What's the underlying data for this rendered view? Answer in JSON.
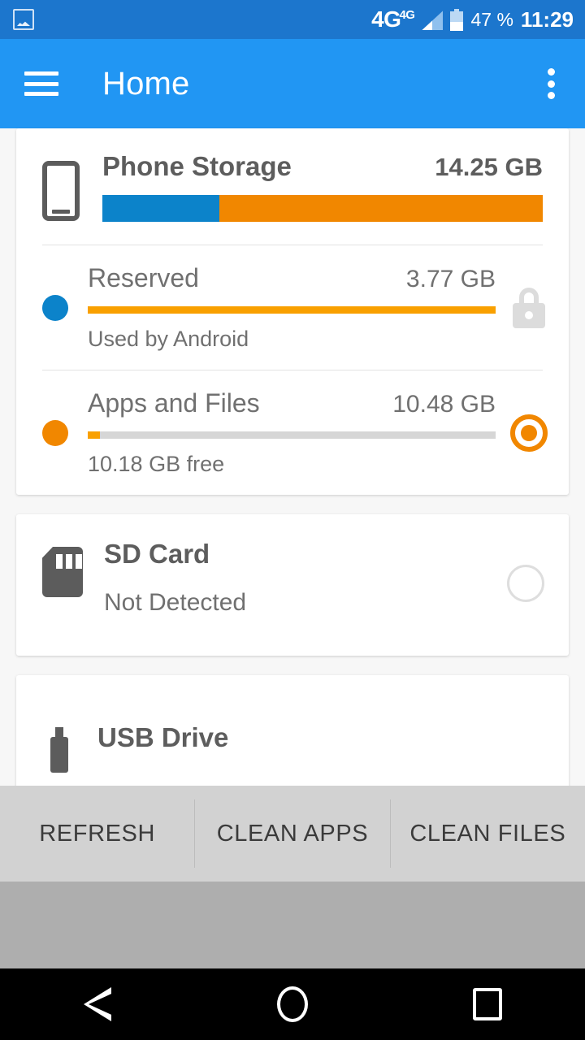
{
  "status_bar": {
    "notification_icon": "image-icon",
    "network_label": "4G",
    "network_sup": "4G",
    "battery_percent": "47 %",
    "clock": "11:29",
    "bar_color": "#1c76cd"
  },
  "app_bar": {
    "menu_icon": "hamburger-icon",
    "title": "Home",
    "overflow_icon": "more-vert-icon",
    "bar_color": "#2196f3"
  },
  "colors": {
    "blue": "#0c83ca",
    "orange": "#f18700",
    "orange_light": "#f9a000",
    "track": "#d6d6d6",
    "text": "#707070",
    "title": "#5d5d5d"
  },
  "phone_storage": {
    "icon": "phone-icon",
    "title": "Phone Storage",
    "size": "14.25 GB",
    "stacked_bar": {
      "segments": [
        {
          "label": "Reserved",
          "color": "#0c83ca",
          "percent": 26.5
        },
        {
          "label": "Apps and Files",
          "color": "#f18700",
          "percent": 73.5
        }
      ]
    },
    "rows": [
      {
        "dot_color": "#0c83ca",
        "name": "Reserved",
        "size": "3.77 GB",
        "bar_percent": 100,
        "note": "Used by Android",
        "trailing_icon": "lock-icon",
        "trailing_type": "lock"
      },
      {
        "dot_color": "#f18700",
        "name": "Apps and Files",
        "size": "10.48 GB",
        "bar_percent": 3,
        "note": "10.18 GB free",
        "trailing_icon": "radio-button-checked-icon",
        "trailing_type": "radio-on"
      }
    ]
  },
  "sd_card": {
    "icon": "sd-card-icon",
    "title": "SD Card",
    "note": "Not Detected",
    "trailing_icon": "radio-button-unchecked-icon"
  },
  "usb_drive": {
    "icon": "usb-drive-icon",
    "title": "USB Drive"
  },
  "bottom_bar": {
    "buttons": [
      {
        "label": "REFRESH"
      },
      {
        "label": "CLEAN APPS"
      },
      {
        "label": "CLEAN FILES"
      }
    ]
  },
  "nav_bar": {
    "back": "back-icon",
    "home": "home-icon",
    "recents": "recents-icon"
  }
}
